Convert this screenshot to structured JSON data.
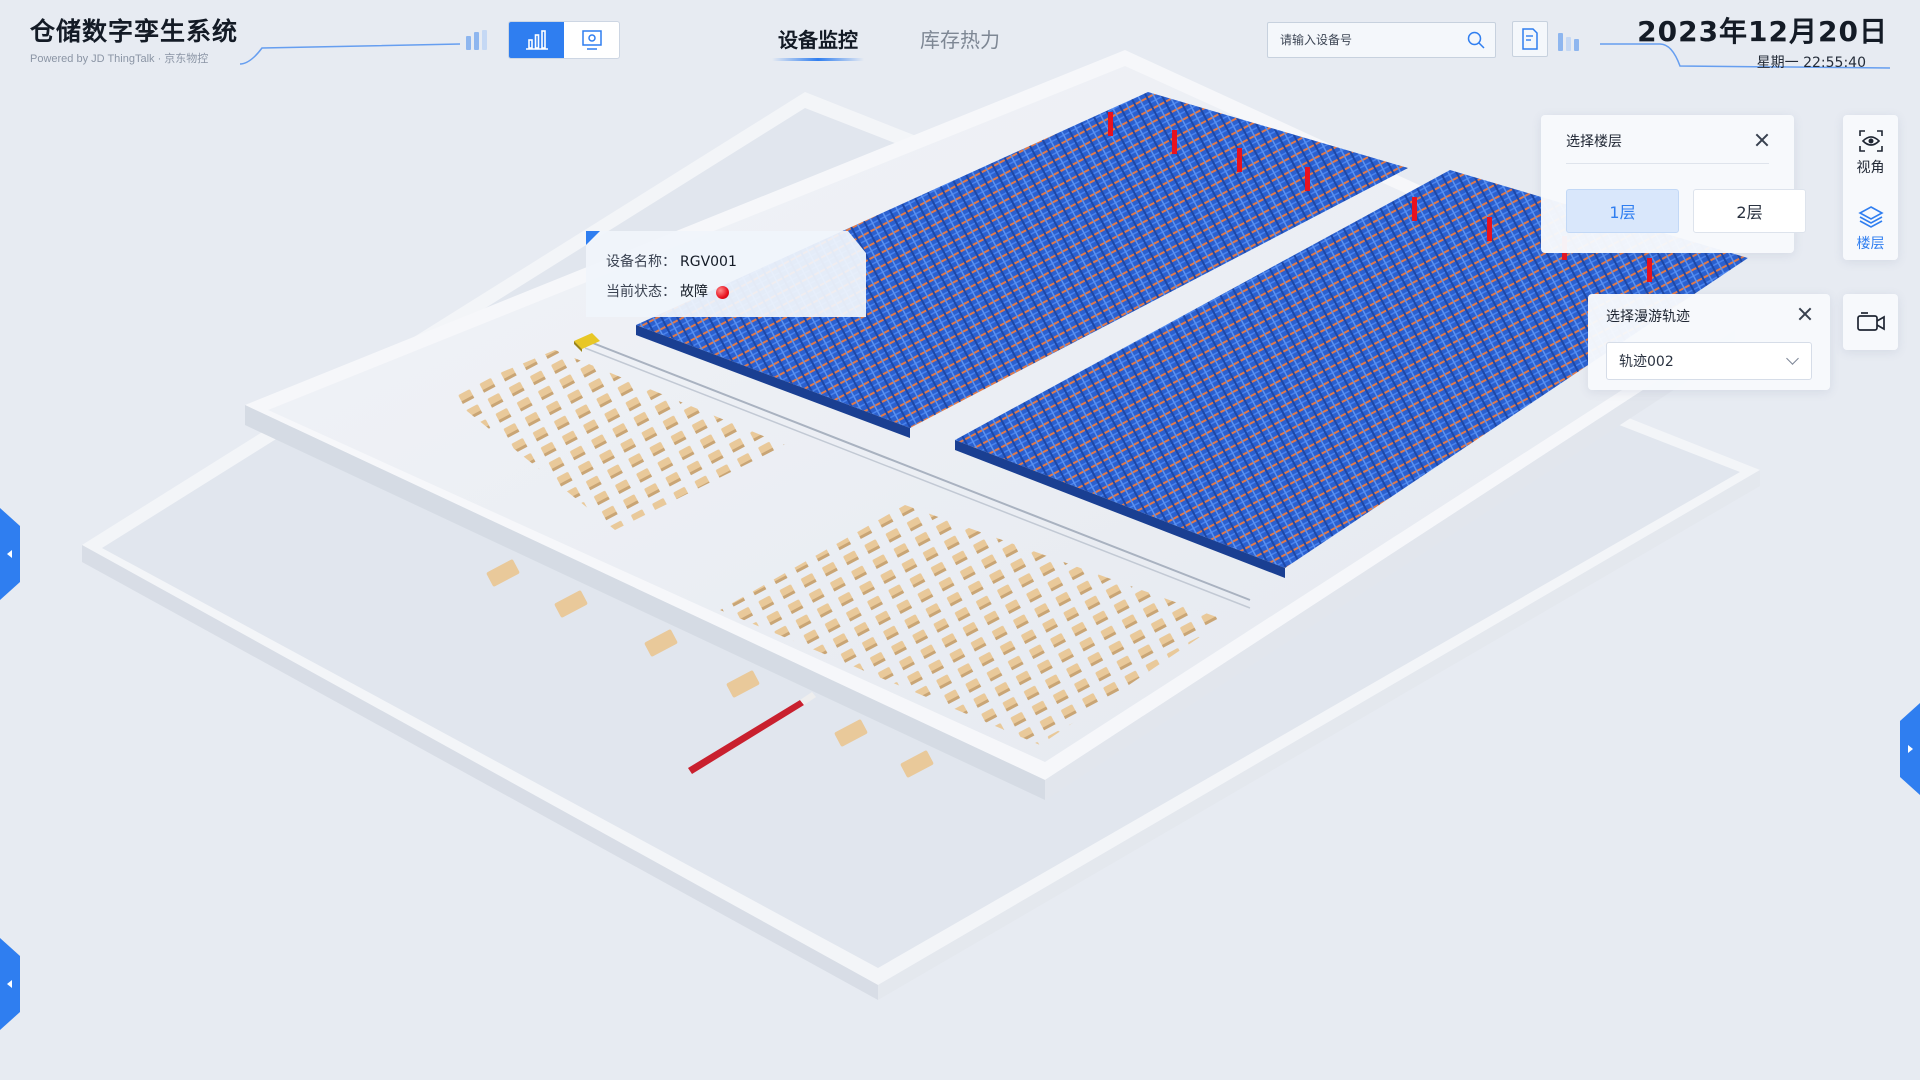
{
  "header": {
    "title": "仓储数字孪生系统",
    "subtitle": "Powered by JD ThingTalk · 京东物控",
    "toolbar": [
      {
        "icon": "bar-chart-icon",
        "active": true
      },
      {
        "icon": "screen-settings-icon",
        "active": false
      }
    ],
    "tabs": [
      {
        "label": "设备监控",
        "active": true
      },
      {
        "label": "库存热力",
        "active": false
      }
    ],
    "search": {
      "placeholder": "请输入设备号",
      "value": ""
    },
    "date": "2023年12月20日",
    "weekday_time": "星期一  22:55:40"
  },
  "device_card": {
    "name_label": "设备名称：",
    "name_value": "RGV001",
    "status_label": "当前状态：",
    "status_value": "故障",
    "status_color": "#e8121f"
  },
  "floor_panel": {
    "title": "选择楼层",
    "floors": [
      {
        "label": "1层",
        "selected": true
      },
      {
        "label": "2层",
        "selected": false
      }
    ]
  },
  "track_panel": {
    "title": "选择漫游轨迹",
    "selected": "轨迹002"
  },
  "side_tools": [
    {
      "label": "视角",
      "icon": "view-angle-icon",
      "active": false
    },
    {
      "label": "楼层",
      "icon": "layers-icon",
      "active": true
    },
    {
      "label": "",
      "icon": "camera-icon",
      "active": false
    }
  ],
  "colors": {
    "accent": "#2f7ef0",
    "background": "#e7ebf2",
    "rack_blue": "#2a63d6",
    "rack_orange": "#d9683c",
    "pallet": "#e9c99a",
    "fault": "#e8121f"
  }
}
